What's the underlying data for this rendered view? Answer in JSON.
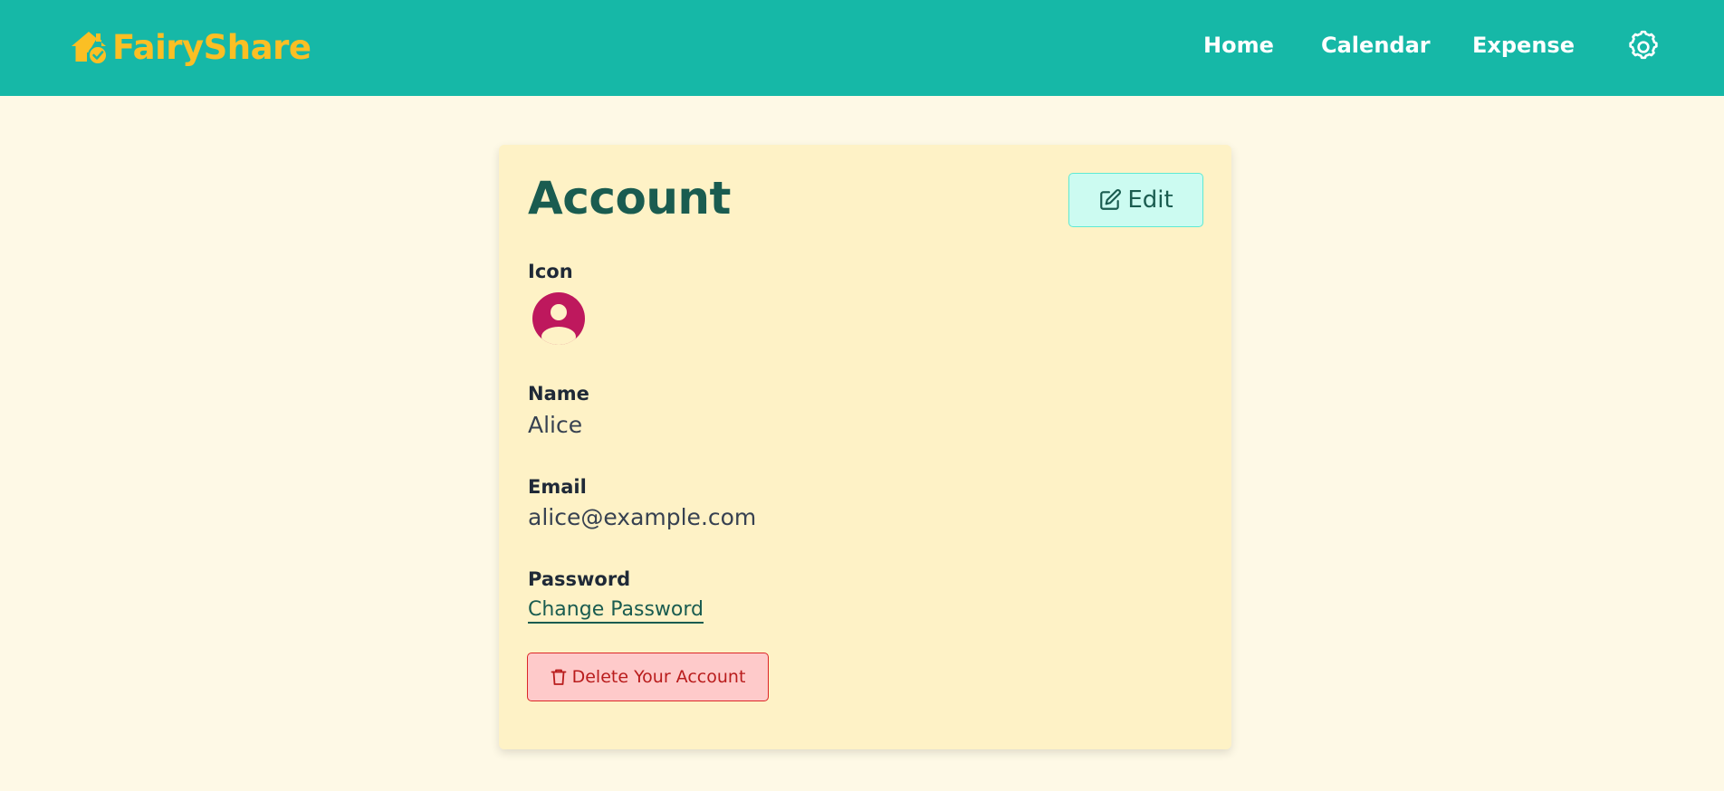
{
  "header": {
    "brand_name": "FairyShare",
    "nav": [
      "Home",
      "Calendar",
      "Expense"
    ],
    "settings_icon": "gear-icon"
  },
  "account": {
    "title": "Account",
    "edit_label": "Edit",
    "icon_label": "Icon",
    "name_label": "Name",
    "name_value": "Alice",
    "email_label": "Email",
    "email_value": "alice@example.com",
    "password_label": "Password",
    "change_password_label": "Change Password",
    "delete_label": "Delete Your Account"
  },
  "colors": {
    "header_bg": "#16b8a7",
    "brand": "#fbbf24",
    "page_bg": "#fef9e6",
    "card_bg": "#fef2c6",
    "accent": "#1a5c50",
    "avatar": "#be185d",
    "danger": "#dc2626"
  }
}
